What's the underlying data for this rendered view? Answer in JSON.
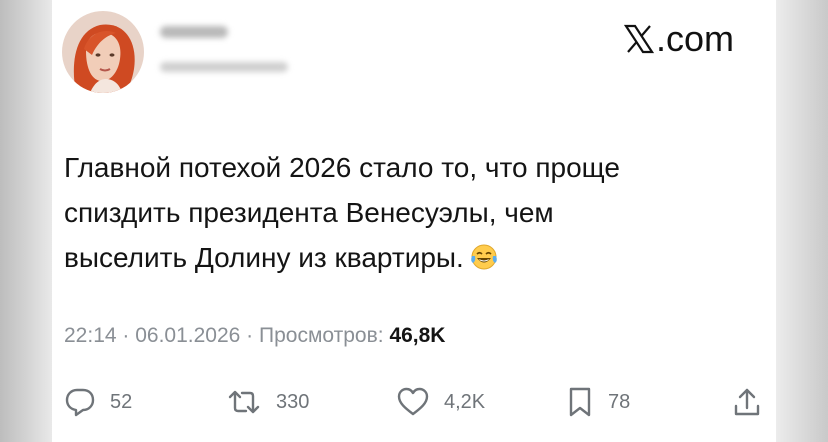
{
  "brand": {
    "logo_suffix": ".com",
    "logo_letter": "X"
  },
  "tweet": {
    "lines": [
      "Главной потехой 2026 стало то, что проще",
      "спиздить президента Венесуэлы, чем",
      "выселить Долину из квартиры."
    ],
    "emoji": "face-with-tears-of-joy"
  },
  "meta": {
    "time": "22:14",
    "sep1": " · ",
    "date": "06.01.2026",
    "sep2": " · ",
    "views_label": "Просмотров: ",
    "views_value": "46,8K"
  },
  "actions": {
    "replies": "52",
    "reposts": "330",
    "likes": "4,2K",
    "bookmarks": "78"
  },
  "icons": {
    "reply": "reply-icon",
    "repost": "repost-icon",
    "like": "heart-icon",
    "bookmark": "bookmark-icon",
    "share": "share-icon"
  },
  "colors": {
    "text": "#141414",
    "muted": "#8a8f95",
    "avatar_hair": "#d8542a"
  }
}
